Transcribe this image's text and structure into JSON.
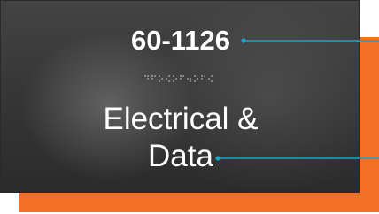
{
  "sign": {
    "room_number": "60-1126",
    "line1": "Electrical &",
    "line2": "Data",
    "braille_icon": "braille-dots"
  },
  "colors": {
    "accent_plate": "#f26f23",
    "face_plate": "#383838",
    "callout_line": "#1aa3c9",
    "text": "#ffffff"
  }
}
